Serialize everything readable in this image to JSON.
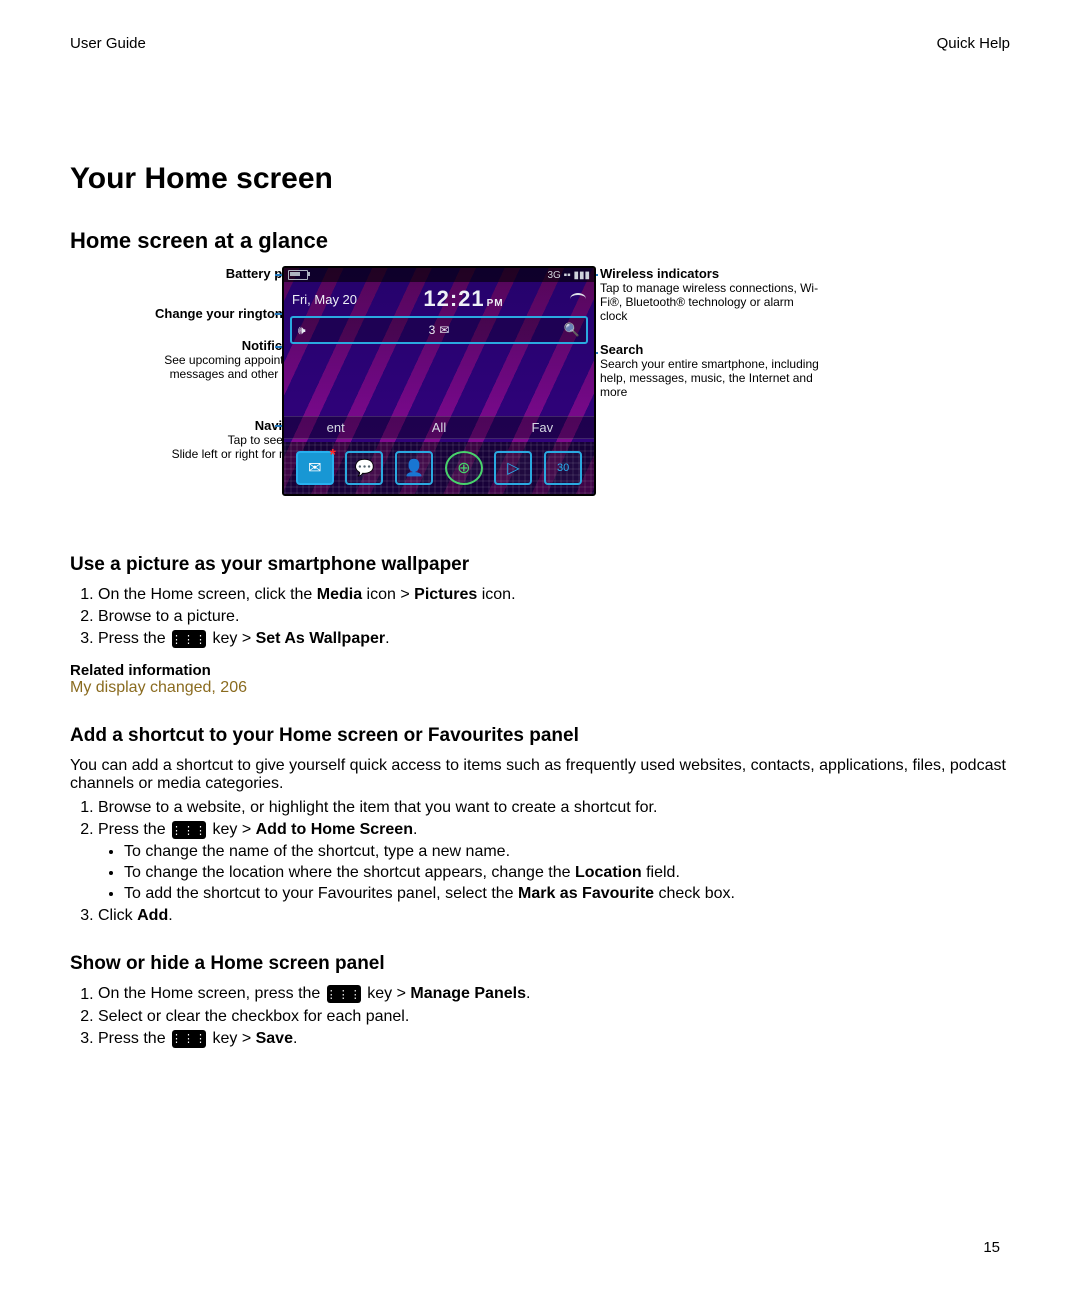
{
  "header": {
    "left": "User Guide",
    "right": "Quick Help"
  },
  "page_number": "15",
  "h1": "Your Home screen",
  "glance": {
    "heading": "Home screen at a glance",
    "callouts_left": {
      "battery": {
        "title": "Battery power level"
      },
      "ringtone": {
        "title": "Change your ringtone or alerts"
      },
      "notif": {
        "title": "Notification view",
        "sub": "See upcoming appointments, new messages and other notifications"
      },
      "navbar": {
        "title": "Navigation bar",
        "sub": "Tap to see more icons\nSlide left or right for more panels"
      }
    },
    "callouts_right": {
      "wireless": {
        "title": "Wireless indicators",
        "sub": "Tap to manage wireless connections, Wi-Fi®, Bluetooth® technology or alarm clock"
      },
      "search": {
        "title": "Search",
        "sub": "Search your entire smartphone, including help, messages, music, the Internet and more"
      }
    },
    "phone": {
      "top_strip_right": "3G ▪▪ ▮▮▮",
      "date": "Fri, May 20",
      "time": "12:21",
      "time_suffix": "PM",
      "notif_count": "3",
      "tabs": {
        "left": "ent",
        "mid": "All",
        "right": "Fav"
      }
    }
  },
  "wallpaper": {
    "heading": "Use a picture as your smartphone wallpaper",
    "step1_a": "On the Home screen, click the ",
    "step1_b": "Media",
    "step1_c": " icon > ",
    "step1_d": "Pictures",
    "step1_e": " icon.",
    "step2": "Browse to a picture.",
    "step3_a": "Press the ",
    "step3_b": " key > ",
    "step3_c": "Set As Wallpaper",
    "step3_d": ".",
    "related_head": "Related information",
    "related_link": "My display changed, 206"
  },
  "shortcut": {
    "heading": "Add a shortcut to your Home screen or Favourites panel",
    "intro": "You can add a shortcut to give yourself quick access to items such as frequently used websites, contacts, applications, files, podcast channels or media categories.",
    "step1": "Browse to a website, or highlight the item that you want to create a shortcut for.",
    "step2_a": "Press the ",
    "step2_b": " key > ",
    "step2_c": "Add to Home Screen",
    "step2_d": ".",
    "sub1": "To change the name of the shortcut, type a new name.",
    "sub2_a": "To change the location where the shortcut appears, change the ",
    "sub2_b": "Location",
    "sub2_c": " field.",
    "sub3_a": "To add the shortcut to your Favourites panel, select the ",
    "sub3_b": "Mark as Favourite",
    "sub3_c": " check box.",
    "step3_a": "Click ",
    "step3_b": "Add",
    "step3_c": "."
  },
  "panels": {
    "heading": "Show or hide a Home screen panel",
    "step1_a": "On the Home screen, press the ",
    "step1_b": " key > ",
    "step1_c": "Manage Panels",
    "step1_d": ".",
    "step2": "Select or clear the checkbox for each panel.",
    "step3_a": "Press the ",
    "step3_b": " key > ",
    "step3_c": "Save",
    "step3_d": "."
  }
}
